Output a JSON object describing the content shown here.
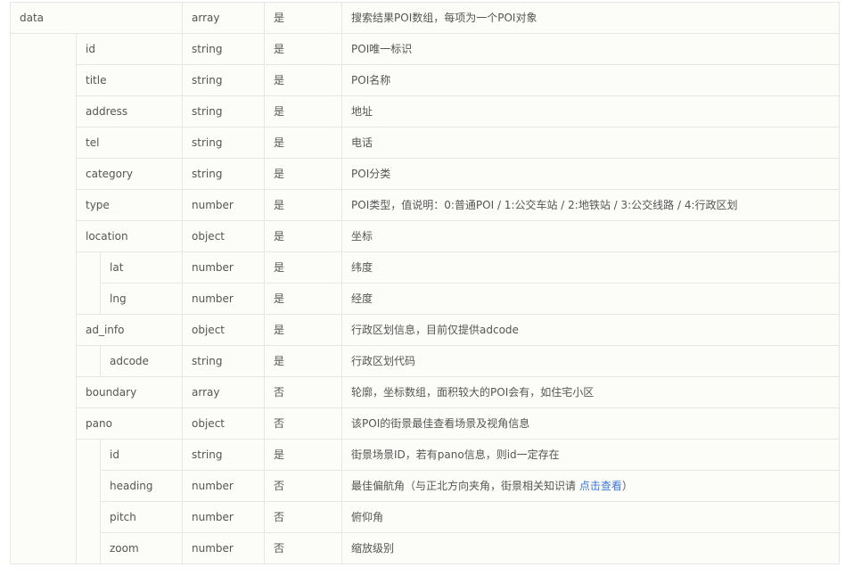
{
  "rows": [
    {
      "level": 0,
      "name": "data",
      "type": "array",
      "required": "是",
      "desc": "搜索结果POI数组，每项为一个POI对象"
    },
    {
      "level": 1,
      "name": "id",
      "type": "string",
      "required": "是",
      "desc": "POI唯一标识"
    },
    {
      "level": 1,
      "name": "title",
      "type": "string",
      "required": "是",
      "desc": "POI名称"
    },
    {
      "level": 1,
      "name": "address",
      "type": "string",
      "required": "是",
      "desc": "地址"
    },
    {
      "level": 1,
      "name": "tel",
      "type": "string",
      "required": "是",
      "desc": "电话"
    },
    {
      "level": 1,
      "name": "category",
      "type": "string",
      "required": "是",
      "desc": "POI分类"
    },
    {
      "level": 1,
      "name": "type",
      "type": "number",
      "required": "是",
      "desc": "POI类型，值说明：0:普通POI / 1:公交车站 / 2:地铁站 / 3:公交线路 / 4:行政区划"
    },
    {
      "level": 1,
      "name": "location",
      "type": "object",
      "required": "是",
      "desc": "坐标"
    },
    {
      "level": 2,
      "name": "lat",
      "type": "number",
      "required": "是",
      "desc": "纬度"
    },
    {
      "level": 2,
      "name": "lng",
      "type": "number",
      "required": "是",
      "desc": "经度"
    },
    {
      "level": 1,
      "name": "ad_info",
      "type": "object",
      "required": "是",
      "desc": "行政区划信息，目前仅提供adcode"
    },
    {
      "level": 2,
      "name": "adcode",
      "type": "string",
      "required": "是",
      "desc": "行政区划代码"
    },
    {
      "level": 1,
      "name": "boundary",
      "type": "array",
      "required": "否",
      "desc": "轮廓，坐标数组，面积较大的POI会有，如住宅小区"
    },
    {
      "level": 1,
      "name": "pano",
      "type": "object",
      "required": "否",
      "desc": "该POI的街景最佳查看场景及视角信息"
    },
    {
      "level": 2,
      "name": "id",
      "type": "string",
      "required": "是",
      "desc": "街景场景ID，若有pano信息，则id一定存在"
    },
    {
      "level": 2,
      "name": "heading",
      "type": "number",
      "required": "否",
      "desc": "最佳偏航角（与正北方向夹角，街景相关知识请 ",
      "link": "点击查看",
      "desc_suffix": "）"
    },
    {
      "level": 2,
      "name": "pitch",
      "type": "number",
      "required": "否",
      "desc": "俯仰角"
    },
    {
      "level": 2,
      "name": "zoom",
      "type": "number",
      "required": "否",
      "desc": "缩放级别"
    }
  ],
  "colors": {
    "border": "#e6e6e6",
    "row_bg": "#fcfcf9",
    "text": "#555555",
    "link": "#3c78d8"
  }
}
